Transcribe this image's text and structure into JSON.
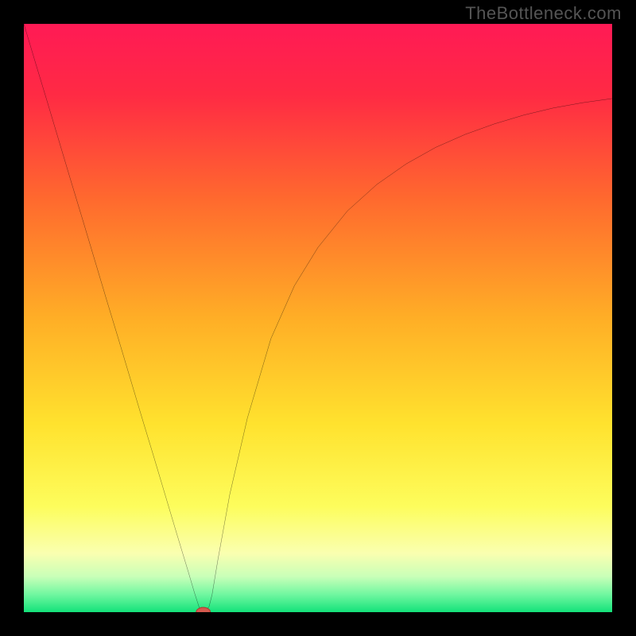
{
  "watermark": "TheBottleneck.com",
  "chart_data": {
    "type": "line",
    "title": "",
    "xlabel": "",
    "ylabel": "",
    "xlim": [
      0,
      100
    ],
    "ylim": [
      0,
      100
    ],
    "grid": false,
    "legend": false,
    "background_gradient": {
      "stops": [
        {
          "offset": 0.0,
          "color": "#ff1a55"
        },
        {
          "offset": 0.12,
          "color": "#ff2a44"
        },
        {
          "offset": 0.3,
          "color": "#ff6a2e"
        },
        {
          "offset": 0.5,
          "color": "#ffae26"
        },
        {
          "offset": 0.68,
          "color": "#ffe22e"
        },
        {
          "offset": 0.82,
          "color": "#fdfd5c"
        },
        {
          "offset": 0.9,
          "color": "#faffb0"
        },
        {
          "offset": 0.94,
          "color": "#c8ffb8"
        },
        {
          "offset": 0.97,
          "color": "#70f7a0"
        },
        {
          "offset": 1.0,
          "color": "#14e27a"
        }
      ]
    },
    "series": [
      {
        "name": "bottleneck-curve",
        "color": "#000000",
        "stroke_width": 2,
        "x": [
          0.0,
          2.0,
          4.0,
          6.0,
          8.0,
          10.0,
          12.0,
          14.0,
          16.0,
          18.0,
          20.0,
          22.0,
          24.0,
          26.0,
          27.0,
          28.0,
          29.0,
          30.0,
          30.5,
          31.0,
          31.5,
          32.0,
          33.0,
          35.0,
          38.0,
          42.0,
          46.0,
          50.0,
          55.0,
          60.0,
          65.0,
          70.0,
          75.0,
          80.0,
          85.0,
          90.0,
          95.0,
          100.0
        ],
        "y": [
          100.0,
          93.3,
          86.7,
          80.0,
          73.3,
          66.7,
          60.0,
          53.3,
          46.7,
          40.0,
          33.3,
          26.7,
          20.0,
          13.3,
          10.0,
          6.7,
          3.3,
          0.2,
          0.0,
          0.2,
          1.0,
          3.0,
          9.0,
          20.0,
          33.0,
          46.5,
          55.5,
          62.0,
          68.2,
          72.7,
          76.2,
          79.0,
          81.2,
          83.0,
          84.5,
          85.7,
          86.6,
          87.3
        ]
      }
    ],
    "markers": [
      {
        "name": "optimal-point",
        "x": 30.5,
        "y": 0.0,
        "rx": 1.2,
        "ry": 0.8,
        "fill": "#d45a4e",
        "stroke": "#b03b32"
      }
    ]
  }
}
